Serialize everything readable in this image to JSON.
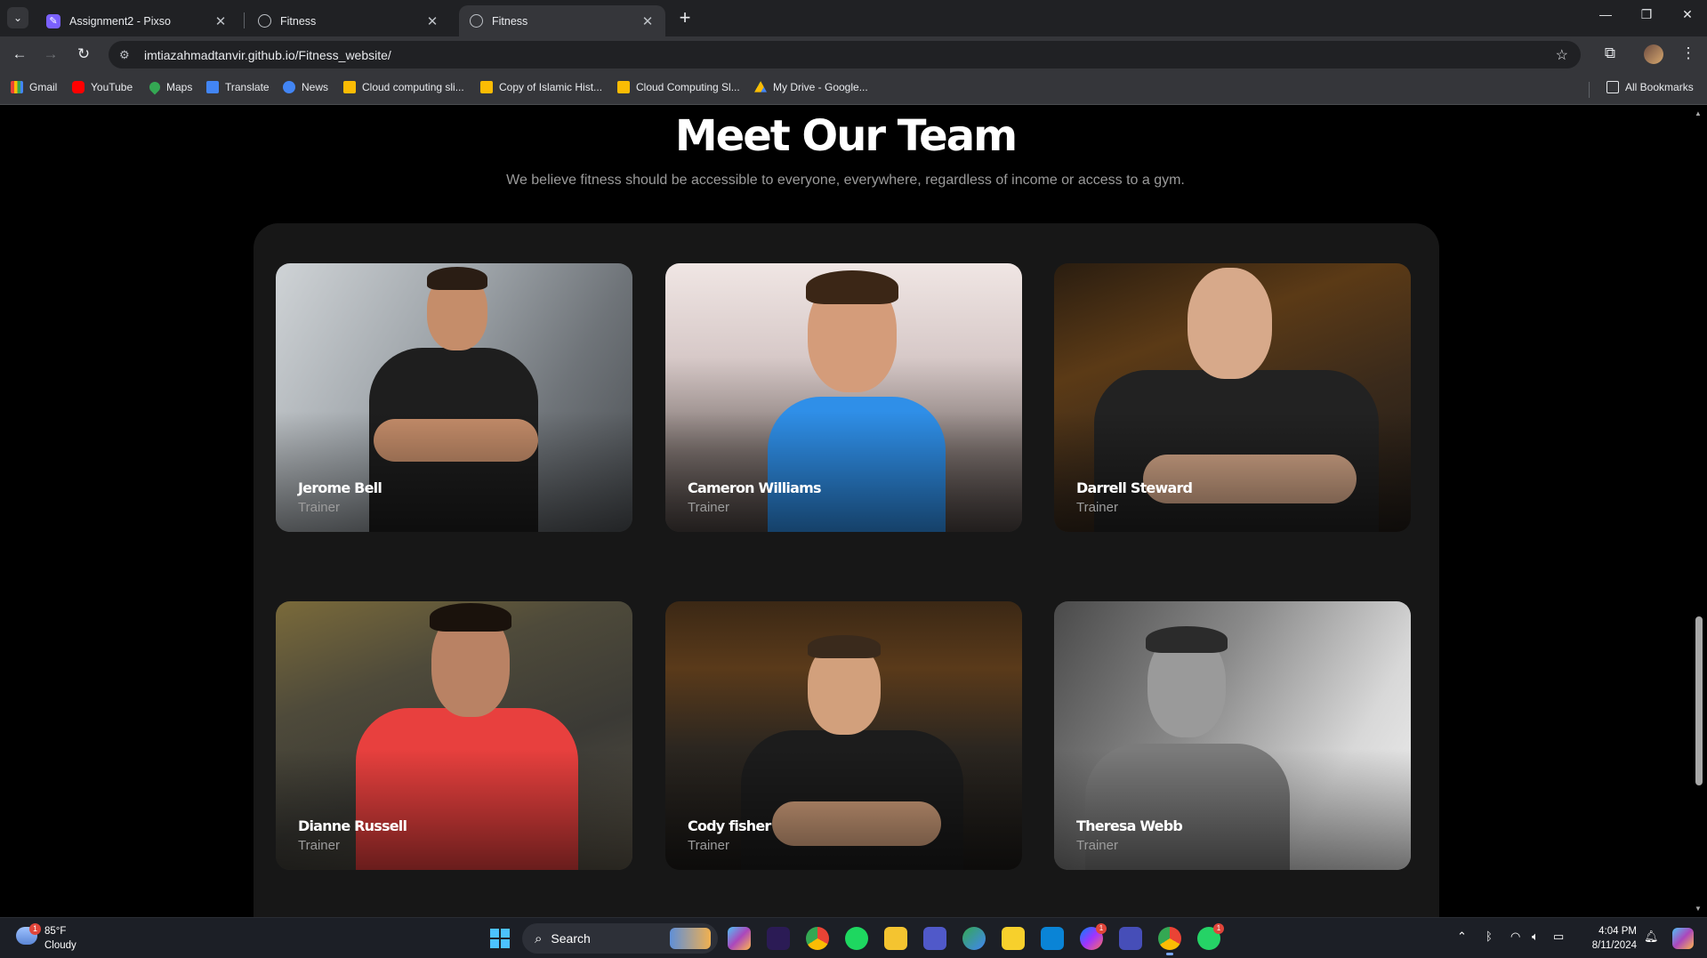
{
  "browser": {
    "tabs": [
      {
        "title": "Assignment2 - Pixso",
        "icon": "pixso-icon",
        "active": false
      },
      {
        "title": "Fitness",
        "icon": "globe-icon",
        "active": false
      },
      {
        "title": "Fitness",
        "icon": "globe-icon",
        "active": true
      }
    ],
    "url": "imtiazahmadtanvir.github.io/Fitness_website/",
    "bookmarks": [
      {
        "label": "Gmail",
        "icon": "gmail-icon"
      },
      {
        "label": "YouTube",
        "icon": "youtube-icon"
      },
      {
        "label": "Maps",
        "icon": "maps-icon"
      },
      {
        "label": "Translate",
        "icon": "translate-icon"
      },
      {
        "label": "News",
        "icon": "news-icon"
      },
      {
        "label": "Cloud computing sli...",
        "icon": "slides-icon"
      },
      {
        "label": "Copy of Islamic Hist...",
        "icon": "slides-icon"
      },
      {
        "label": "Cloud Computing Sl...",
        "icon": "slides-icon"
      },
      {
        "label": "My Drive - Google...",
        "icon": "drive-icon"
      }
    ],
    "all_bookmarks": "All Bookmarks"
  },
  "page": {
    "heading": "Meet Our Team",
    "subheading": "We believe fitness should be accessible to everyone, everywhere, regardless of income or access to a gym.",
    "team": [
      {
        "name": "Jerome Bell",
        "role": "Trainer",
        "shirt": "#1e1e1e",
        "skin": "#c58d6a",
        "hair": "#2a1d14"
      },
      {
        "name": "Cameron Williams",
        "role": "Trainer",
        "shirt": "#2f8fe8",
        "skin": "#d49c7a",
        "hair": "#3b2616"
      },
      {
        "name": "Darrell Steward",
        "role": "Trainer",
        "shirt": "#222222",
        "skin": "#d7a98a",
        "hair": "#c99a80"
      },
      {
        "name": "Dianne Russell",
        "role": "Trainer",
        "shirt": "#e8403e",
        "skin": "#b98264",
        "hair": "#1a120c"
      },
      {
        "name": "Cody fisher",
        "role": "Trainer",
        "shirt": "#1c1c1c",
        "skin": "#d2a07c",
        "hair": "#3a2a1c"
      },
      {
        "name": "Theresa Webb",
        "role": "Trainer",
        "shirt": "#7b7b7b",
        "skin": "#9a9a9a",
        "hair": "#2b2b2b"
      }
    ]
  },
  "taskbar": {
    "weather_temp": "85°F",
    "weather_desc": "Cloudy",
    "weather_badge": "1",
    "search_label": "Search",
    "time": "4:04 PM",
    "date": "8/11/2024",
    "messenger_badge": "1",
    "whatsapp_badge": "1"
  }
}
